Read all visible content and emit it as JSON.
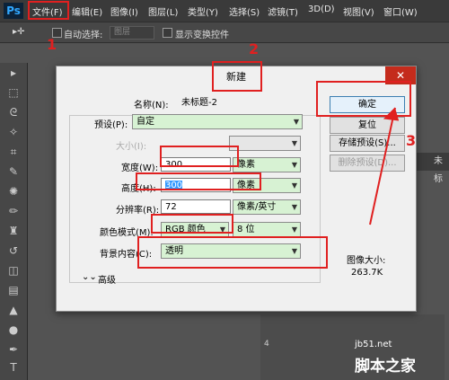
{
  "app": {
    "logo": "Ps"
  },
  "menu": [
    "文件(F)",
    "编辑(E)",
    "图像(I)",
    "图层(L)",
    "类型(Y)",
    "选择(S)",
    "滤镜(T)",
    "3D(D)",
    "视图(V)",
    "窗口(W)"
  ],
  "options": {
    "auto_select": "自动选择:",
    "layer_select": "图层",
    "show_transform": "显示变换控件"
  },
  "right_panel_label": "未标",
  "ruler_value": "4",
  "dialog": {
    "title": "新建",
    "close": "✕",
    "name_label": "名称(N):",
    "name_value": "未标题-2",
    "preset_label": "预设(P):",
    "preset_value": "自定",
    "size_label": "大小(I):",
    "width_label": "宽度(W):",
    "width_value": "300",
    "width_unit": "像素",
    "height_label": "高度(H):",
    "height_value": "300",
    "height_unit": "像素",
    "resolution_label": "分辨率(R):",
    "resolution_value": "72",
    "resolution_unit": "像素/英寸",
    "color_mode_label": "颜色模式(M):",
    "color_mode_value": "RGB 颜色",
    "bit_depth": "8 位",
    "background_label": "背景内容(C):",
    "background_value": "透明",
    "advanced_label": "高级",
    "buttons": {
      "ok": "确定",
      "reset": "复位",
      "save_preset": "存储预设(S)...",
      "delete_preset": "删除预设(D)..."
    },
    "image_size_label": "图像大小:",
    "image_size_value": "263.7K"
  },
  "annotations": [
    "1",
    "2",
    "3"
  ],
  "watermark": {
    "line1": "jb51.net",
    "line2": "脚本之家"
  },
  "colors": {
    "accent": "#e02020",
    "combo_bg": "#d7f2d3"
  }
}
